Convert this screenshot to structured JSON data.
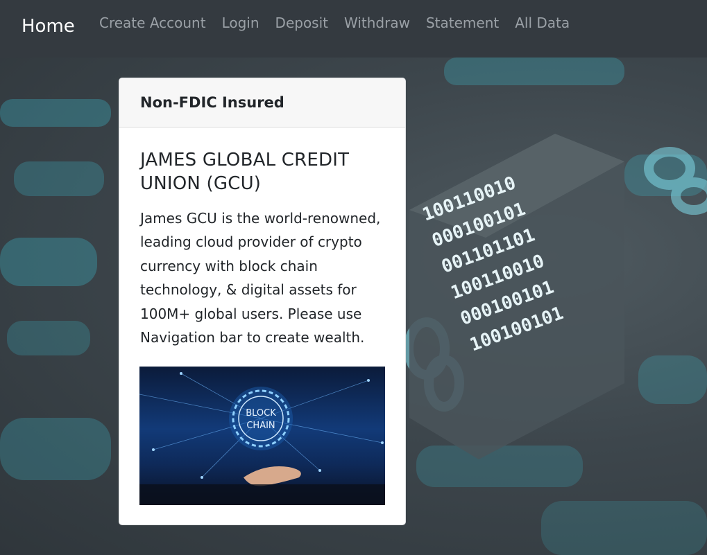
{
  "navbar": {
    "brand": "Home",
    "links": [
      "Create Account",
      "Login",
      "Deposit",
      "Withdraw",
      "Statement",
      "All Data"
    ]
  },
  "card": {
    "header": "Non-FDIC Insured",
    "title": "JAMES GLOBAL CREDIT UNION (GCU)",
    "text": "James GCU is the world-renowned, leading cloud provider of crypto currency with block chain technology, & digital assets for 100M+ global users. Please use Navigation bar to create wealth.",
    "image": {
      "label_line1": "BLOCK",
      "label_line2": "CHAIN"
    }
  },
  "background": {
    "binary_rows": [
      "100110010",
      "000100101",
      "001101101",
      "100110010",
      "000100101",
      "100100101"
    ]
  },
  "colors": {
    "navbar": "#343a40",
    "nav_link": "#9aa0a6",
    "brand": "#ffffff",
    "accent": "#3fb6c8"
  }
}
